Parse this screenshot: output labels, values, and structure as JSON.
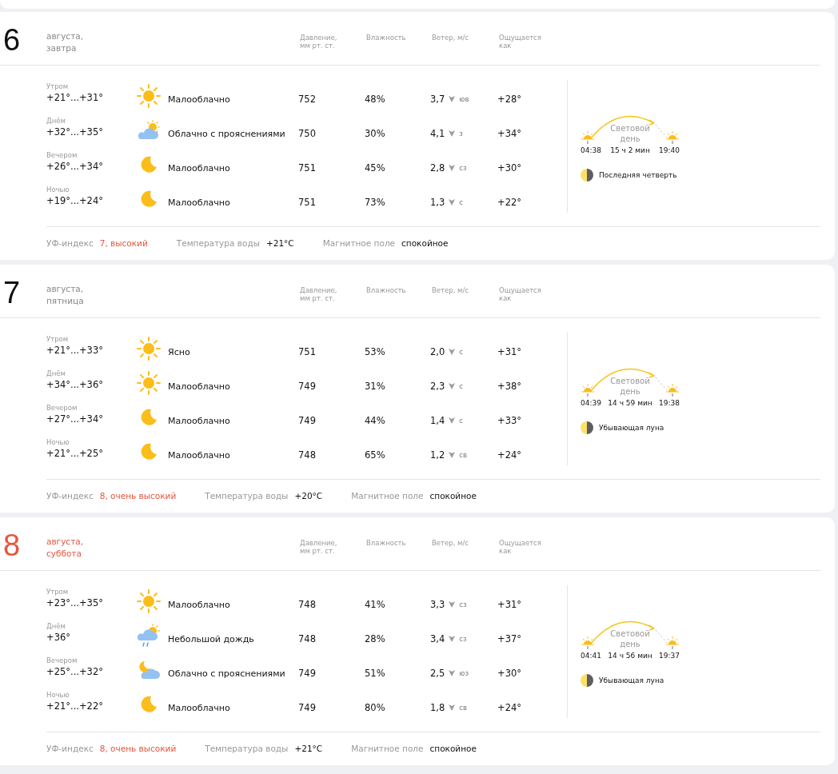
{
  "days": [
    {
      "day": "6",
      "date": "августа,",
      "weekday": "завтра",
      "weekend": false,
      "columns": [
        "Давление, мм рт. ст.",
        "Влажность",
        "Ветер, м/с",
        "Ощущается как"
      ],
      "rows": [
        {
          "period": "Утром",
          "temp": "+21°...+31°",
          "kind": "sun",
          "condition": "Малооблачно",
          "pressure": "752",
          "humidity": "48%",
          "wind": "3,7",
          "direction": "юв",
          "feels": "+28°"
        },
        {
          "period": "Днём",
          "temp": "+32°...+35°",
          "kind": "cloud-sun",
          "condition": "Облачно с прояснениями",
          "pressure": "750",
          "humidity": "30%",
          "wind": "4,1",
          "direction": "з",
          "feels": "+34°"
        },
        {
          "period": "Вечером",
          "temp": "+26°...+34°",
          "kind": "moon",
          "condition": "Малооблачно",
          "pressure": "751",
          "humidity": "45%",
          "wind": "2,8",
          "direction": "сз",
          "feels": "+30°"
        },
        {
          "period": "Ночью",
          "temp": "+19°...+24°",
          "kind": "moon",
          "condition": "Малооблачно",
          "pressure": "751",
          "humidity": "73%",
          "wind": "1,3",
          "direction": "с",
          "feels": "+22°"
        }
      ],
      "sun": {
        "label": "Световой день",
        "sunrise": "04:38",
        "length": "15 ч 2 мин",
        "sunset": "19:40"
      },
      "moon": "Последняя четверть",
      "footer": [
        {
          "label": "УФ-индекс",
          "value": "7, высокий",
          "kind": "warning"
        },
        {
          "label": "Температура воды",
          "value": "+21°C",
          "kind": "plain"
        },
        {
          "label": "Магнитное поле",
          "value": "спокойное",
          "kind": "plain"
        }
      ]
    },
    {
      "day": "7",
      "date": "августа,",
      "weekday": "пятница",
      "weekend": false,
      "columns": [
        "Давление, мм рт. ст.",
        "Влажность",
        "Ветер, м/с",
        "Ощущается как"
      ],
      "rows": [
        {
          "period": "Утром",
          "temp": "+21°...+33°",
          "kind": "sun",
          "condition": "Ясно",
          "pressure": "751",
          "humidity": "53%",
          "wind": "2,0",
          "direction": "с",
          "feels": "+31°"
        },
        {
          "period": "Днём",
          "temp": "+34°...+36°",
          "kind": "sun",
          "condition": "Малооблачно",
          "pressure": "749",
          "humidity": "31%",
          "wind": "2,3",
          "direction": "с",
          "feels": "+38°"
        },
        {
          "period": "Вечером",
          "temp": "+27°...+34°",
          "kind": "moon",
          "condition": "Малооблачно",
          "pressure": "749",
          "humidity": "44%",
          "wind": "1,4",
          "direction": "с",
          "feels": "+33°"
        },
        {
          "period": "Ночью",
          "temp": "+21°...+25°",
          "kind": "moon",
          "condition": "Малооблачно",
          "pressure": "748",
          "humidity": "65%",
          "wind": "1,2",
          "direction": "св",
          "feels": "+24°"
        }
      ],
      "sun": {
        "label": "Световой день",
        "sunrise": "04:39",
        "length": "14 ч 59 мин",
        "sunset": "19:38"
      },
      "moon": "Убывающая луна",
      "footer": [
        {
          "label": "УФ-индекс",
          "value": "8, очень высокий",
          "kind": "warning"
        },
        {
          "label": "Температура воды",
          "value": "+20°C",
          "kind": "plain"
        },
        {
          "label": "Магнитное поле",
          "value": "спокойное",
          "kind": "plain"
        }
      ]
    },
    {
      "day": "8",
      "date": "августа,",
      "weekday": "суббота",
      "weekend": true,
      "columns": [
        "Давление, мм рт. ст.",
        "Влажность",
        "Ветер, м/с",
        "Ощущается как"
      ],
      "rows": [
        {
          "period": "Утром",
          "temp": "+23°...+35°",
          "kind": "sun",
          "condition": "Малооблачно",
          "pressure": "748",
          "humidity": "41%",
          "wind": "3,3",
          "direction": "сз",
          "feels": "+31°"
        },
        {
          "period": "Днём",
          "temp": "+36°",
          "kind": "rain",
          "condition": "Небольшой дождь",
          "pressure": "748",
          "humidity": "28%",
          "wind": "3,4",
          "direction": "сз",
          "feels": "+37°"
        },
        {
          "period": "Вечером",
          "temp": "+25°...+32°",
          "kind": "moon-cloud",
          "condition": "Облачно с прояснениями",
          "pressure": "749",
          "humidity": "51%",
          "wind": "2,5",
          "direction": "юз",
          "feels": "+30°"
        },
        {
          "period": "Ночью",
          "temp": "+21°...+22°",
          "kind": "moon",
          "condition": "Малооблачно",
          "pressure": "749",
          "humidity": "80%",
          "wind": "1,8",
          "direction": "св",
          "feels": "+24°"
        }
      ],
      "sun": {
        "label": "Световой день",
        "sunrise": "04:41",
        "length": "14 ч 56 мин",
        "sunset": "19:37"
      },
      "moon": "Убывающая луна",
      "footer": [
        {
          "label": "УФ-индекс",
          "value": "8, очень высокий",
          "kind": "warning"
        },
        {
          "label": "Температура воды",
          "value": "+21°C",
          "kind": "plain"
        },
        {
          "label": "Магнитное поле",
          "value": "спокойное",
          "kind": "plain"
        }
      ]
    }
  ]
}
